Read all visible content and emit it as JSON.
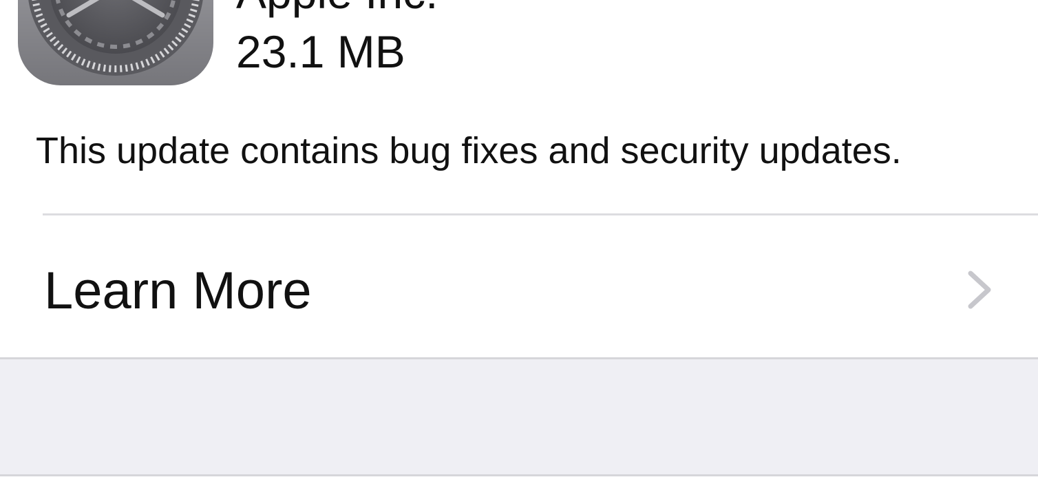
{
  "update": {
    "icon": "settings-gear-icon",
    "developer": "Apple Inc.",
    "size": "23.1 MB",
    "description": "This update contains bug fixes and security updates."
  },
  "learn_more": {
    "label": "Learn More",
    "icon": "chevron-right-icon"
  },
  "colors": {
    "background": "#ffffff",
    "grouped_background": "#efeff4",
    "separator": "#dcdce0",
    "chevron": "#c7c7cc",
    "text": "#111111"
  }
}
